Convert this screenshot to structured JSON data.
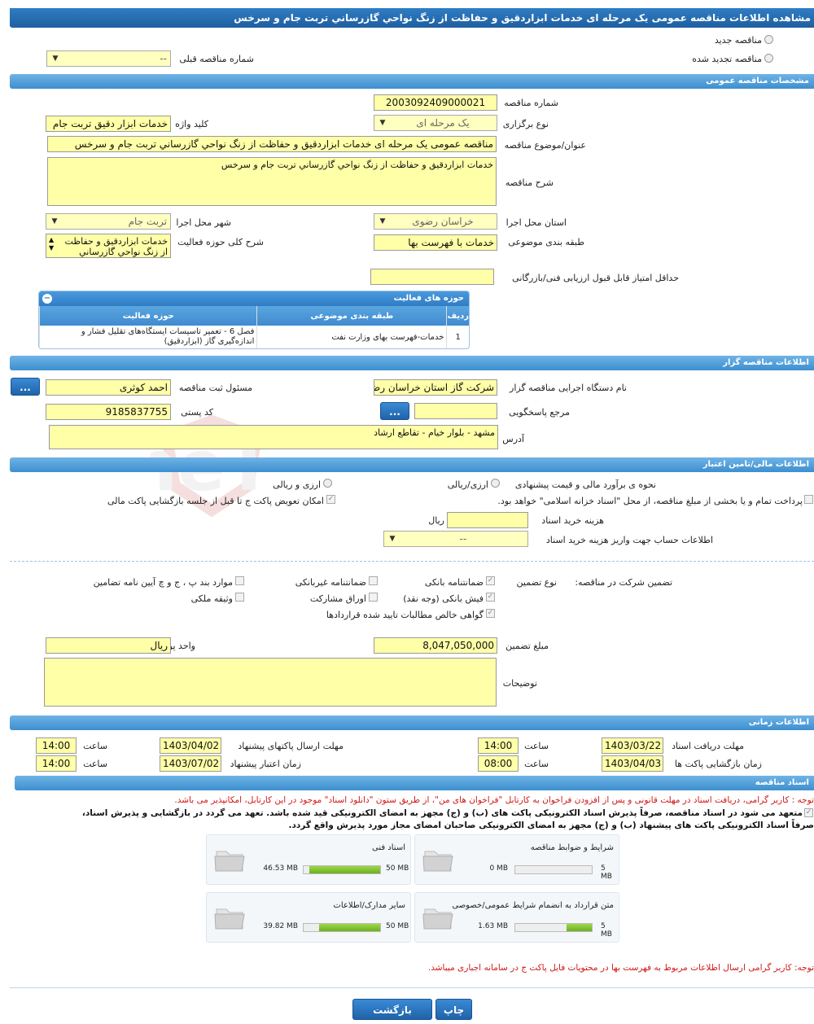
{
  "header": {
    "title": "مشاهده اطلاعات مناقصه عمومی یک مرحله ای خدمات ابزاردقیق و حفاظت از زنگ نواحي گازرساني تربت جام و سرخس"
  },
  "tender_type": {
    "new_label": "مناقصه جدید",
    "renewed_label": "مناقصه تجدید شده",
    "previous_no_label": "شماره مناقصه قبلی",
    "previous_no_value": "--"
  },
  "general": {
    "section_title": "مشخصات مناقصه عمومی",
    "number_label": "شماره مناقصه",
    "number_value": "2003092409000021",
    "holding_label": "نوع برگزاری",
    "holding_value": "یک مرحله ای",
    "keyword_label": "کلید واژه",
    "keyword_value": "خدمات ابزار دقیق تربت جام",
    "subject_label": "عنوان/موضوع مناقصه",
    "subject_value": "مناقصه عمومی یک مرحله ای خدمات ابزاردقیق و حفاظت از زنگ نواحي گازرساني تربت جام و سرخس",
    "description_label": "شرح مناقصه",
    "description_value": "خدمات ابزاردقیق و حفاظت از زنگ نواحي گازرساني تربت جام و سرخس",
    "province_label": "استان محل اجرا",
    "province_value": "خراسان رضوی",
    "city_label": "شهر محل اجرا",
    "city_value": "تربت جام",
    "category_label": "طبقه بندی موضوعی",
    "category_value": "خدمات با فهرست بها",
    "activity_desc_label": "شرح کلی حوزه فعالیت",
    "activity_desc_value": "خدمات ابزاردقیق و حفاظت از زنگ نواحي گازرساني",
    "min_score_label": "حداقل امتیاز قابل قبول ارزیابی فنی/بازرگانی",
    "min_score_value": ""
  },
  "activities": {
    "title": "حوزه های فعالیت",
    "headers": [
      "ردیف",
      "طبقه بندی موضوعی",
      "حوزه فعالیت"
    ],
    "rows": [
      {
        "idx": "1",
        "category": "خدمات-فهرست بهای وزارت نفت",
        "field": "فصل 6 - تعمیر تاسیسات ایستگاه‌های تقلیل فشار و اندازه‌گیری گاز (ابزاردقیق)"
      }
    ]
  },
  "organizer": {
    "section_title": "اطلاعات مناقصه گزار",
    "org_label": "نام دستگاه اجرایی مناقصه گزار",
    "org_value": "شرکت گاز استان خراسان رضوی",
    "registrar_label": "مسئول ثبت مناقصه",
    "registrar_value": "احمد کوثری",
    "reference_label": "مرجع پاسخگویی",
    "reference_value": "",
    "postal_label": "کد پستی",
    "postal_value": "9185837755",
    "address_label": "آدرس",
    "address_value": "مشهد - بلوار خیام - تقاطع ارشاد",
    "dots": "..."
  },
  "finance": {
    "section_title": "اطلاعات مالی/تامین اعتبار",
    "estimate_label": "نحوه ی برآورد مالی و قیمت پیشنهادی",
    "opt_rial_currency": "ارزی/ریالی",
    "opt_currency_rial": "ارزی و ریالی",
    "treasury_text": "پرداخت تمام و یا بخشی از مبلغ مناقصه، از محل \"اسناد خزانه اسلامی\" خواهد بود.",
    "swap_text": "امکان تعویض پاکت ج تا قبل از جلسه بازگشایی پاکت مالی",
    "doc_cost_label": "هزینه خرید اسناد",
    "doc_cost_value": "",
    "doc_cost_unit": "ریال",
    "account_label": "اطلاعات حساب جهت واریز هزینه خرید اسناد",
    "account_value": "--"
  },
  "guarantee": {
    "label": "تضمین شرکت در مناقصه:",
    "type_label": "نوع تضمین",
    "opts": {
      "bank_guarantee": "ضمانتنامه بانکی",
      "nonbank_guarantee": "ضمانتنامه غیربانکی",
      "clauses": "موارد بند پ ، ج و چ آیین نامه تضامین",
      "bank_receipt": "فیش بانکی (وجه نقد)",
      "bonds": "اوراق مشارکت",
      "property": "وثیقه ملکی",
      "claims": "گواهی خالص مطالبات تایید شده قراردادها"
    },
    "amount_label": "مبلغ تضمین",
    "amount_value": "8,047,050,000",
    "currency_label": "واحد پول",
    "currency_value": "ریال",
    "notes_label": "توضیحات",
    "notes_value": ""
  },
  "timing": {
    "section_title": "اطلاعات زمانی",
    "receive_label": "مهلت دریافت اسناد",
    "receive_date": "1403/03/22",
    "receive_time": "14:00",
    "submit_label": "مهلت ارسال پاکتهای پیشنهاد",
    "submit_date": "1403/04/02",
    "submit_time": "14:00",
    "open_label": "زمان بازگشایی پاکت ها",
    "open_date": "1403/04/03",
    "open_time": "08:00",
    "validity_label": "زمان اعتبار پیشنهاد",
    "validity_date": "1403/07/02",
    "validity_time": "14:00",
    "time_label": "ساعت"
  },
  "docs": {
    "section_title": "اسناد مناقصه",
    "note1": "توجه : کاربر گرامی، دریافت اسناد در مهلت قانونی و پس از افزودن فراخوان به کارتابل \"فراخوان های من\"، از طریق ستون \"دانلود اسناد\" موجود در این کارتابل، امکانپذیر می باشد.",
    "commit1": "متعهد می شود در اسناد مناقصه، صرفاً پذیرش اسناد الکترونیکی پاکت های (ب) و (ج) مجهز به امضای الکترونیکی قید شده باشد. تعهد می گردد در بازگشایی و پذیرش اسناد،",
    "commit2": "صرفاً اسناد الکترونیکی پاکت های پیشنهاد (ب) و (ج) مجهز به امضای الکترونیکی صاحبان امضای مجاز مورد پذیرش واقع گردد.",
    "note2": "توجه: کاربر گرامی ارسال اطلاعات مربوط به فهرست بها در محتویات فایل پاکت ج در سامانه اجباری میباشد.",
    "cards": [
      {
        "title": "شرایط و ضوابط مناقصه",
        "max": "5 MB",
        "current": "0 MB",
        "fill": 0
      },
      {
        "title": "اسناد فنی",
        "max": "50 MB",
        "current": "46.53 MB",
        "fill": 0.93
      },
      {
        "title": "متن قرارداد به انضمام شرایط عمومی/خصوصی",
        "max": "5 MB",
        "current": "1.63 MB",
        "fill": 0.33
      },
      {
        "title": "سایر مدارک/اطلاعات",
        "max": "50 MB",
        "current": "39.82 MB",
        "fill": 0.8
      }
    ]
  },
  "actions": {
    "print": "چاپ",
    "back": "بازگشت"
  },
  "watermark": {
    "text": "AriaTender.neT"
  }
}
